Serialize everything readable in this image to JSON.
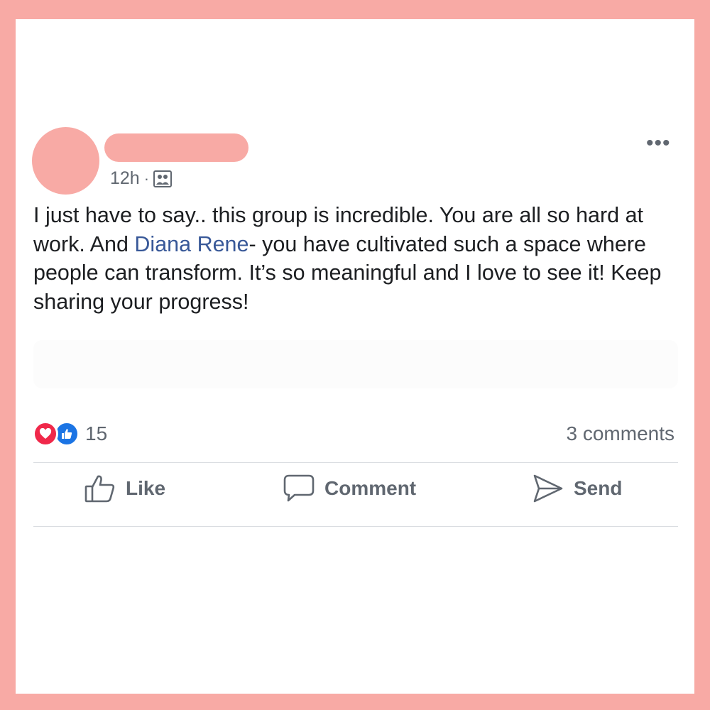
{
  "post": {
    "time": "12h",
    "separator": "·",
    "audience_icon": "group-icon",
    "more_label": "•••",
    "text_before_mention": "I just have to say.. this group is incredible. You are all so hard at work. And ",
    "mention": "Diana Rene",
    "text_after_mention": "- you have cultivated such a space where people can transform. It’s so meaningful and I love to see it! Keep sharing your progress!"
  },
  "engagement": {
    "reaction_icons": [
      "love-reaction-icon",
      "like-reaction-icon"
    ],
    "reaction_count": "15",
    "comments_count": "3 comments"
  },
  "actions": {
    "like_label": "Like",
    "comment_label": "Comment",
    "send_label": "Send"
  },
  "colors": {
    "frame": "#f8aaa5",
    "mention": "#385898",
    "love": "#f0284a",
    "like": "#1b74e4"
  }
}
